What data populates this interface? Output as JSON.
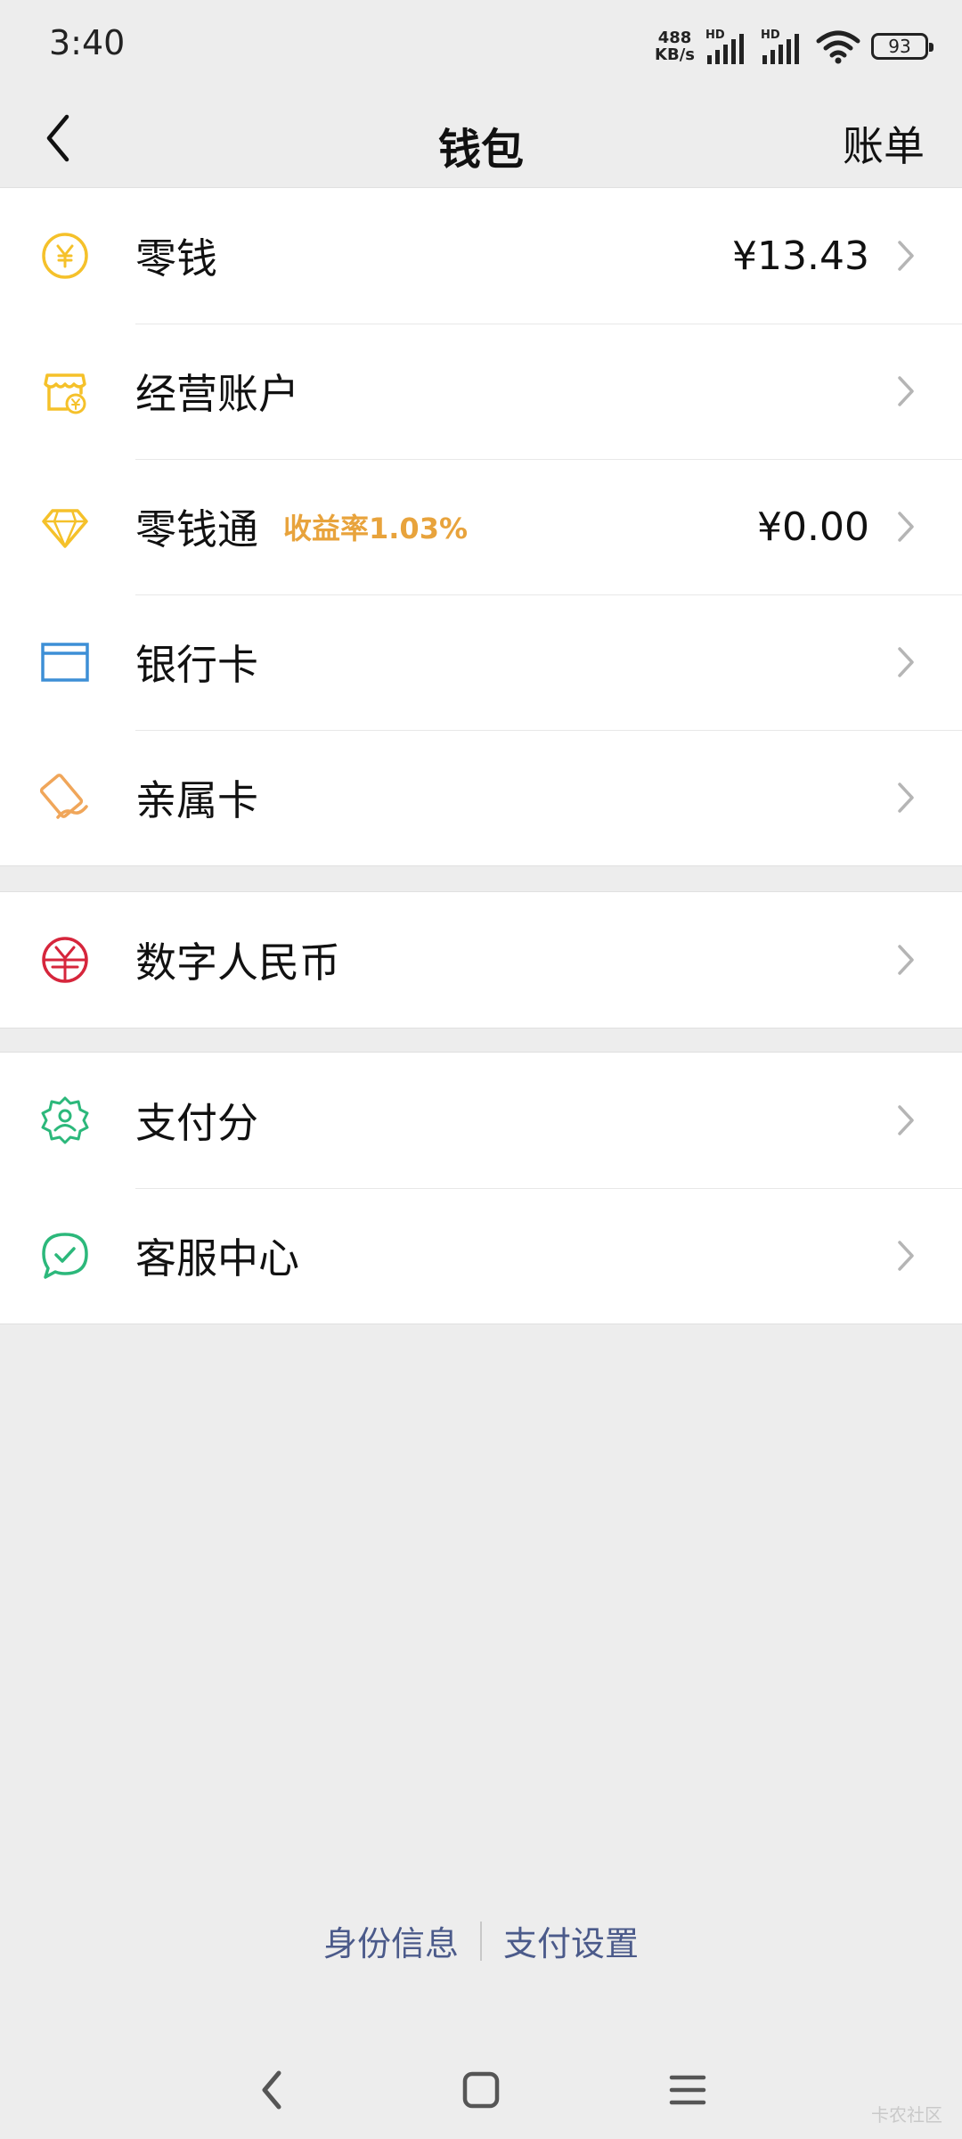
{
  "status_bar": {
    "time": "3:40",
    "net_speed_value": "488",
    "net_speed_unit": "KB/s",
    "signal_label_1": "HD",
    "signal_label_2": "HD",
    "battery": "93"
  },
  "nav": {
    "title": "钱包",
    "right_label": "账单",
    "back_icon": "back-arrow-icon"
  },
  "groups": [
    {
      "rows": [
        {
          "label": "零钱",
          "value": "¥13.43",
          "icon": "coin-yen-icon",
          "icon_color": "#f5c12a"
        },
        {
          "label": "经营账户",
          "icon": "shop-account-icon",
          "icon_color": "#f5c12a"
        },
        {
          "label": "零钱通",
          "tag": "收益率1.03%",
          "value": "¥0.00",
          "icon": "diamond-icon",
          "icon_color": "#f5c12a"
        },
        {
          "label": "银行卡",
          "icon": "bank-card-icon",
          "icon_color": "#3d8fd6"
        },
        {
          "label": "亲属卡",
          "icon": "family-card-icon",
          "icon_color": "#f0a65a"
        }
      ]
    },
    {
      "rows": [
        {
          "label": "数字人民币",
          "icon": "digital-rmb-icon",
          "icon_color": "#d6263c"
        }
      ]
    },
    {
      "rows": [
        {
          "label": "支付分",
          "icon": "pay-score-icon",
          "icon_color": "#2cb87b"
        },
        {
          "label": "客服中心",
          "icon": "customer-service-icon",
          "icon_color": "#2cb87b"
        }
      ]
    }
  ],
  "footer": {
    "link_identity": "身份信息",
    "link_settings": "支付设置"
  },
  "watermark": "卡农社区",
  "colors": {
    "background": "#ededed",
    "card": "#ffffff",
    "tag": "#e8a33c",
    "link": "#4b5a8a"
  }
}
